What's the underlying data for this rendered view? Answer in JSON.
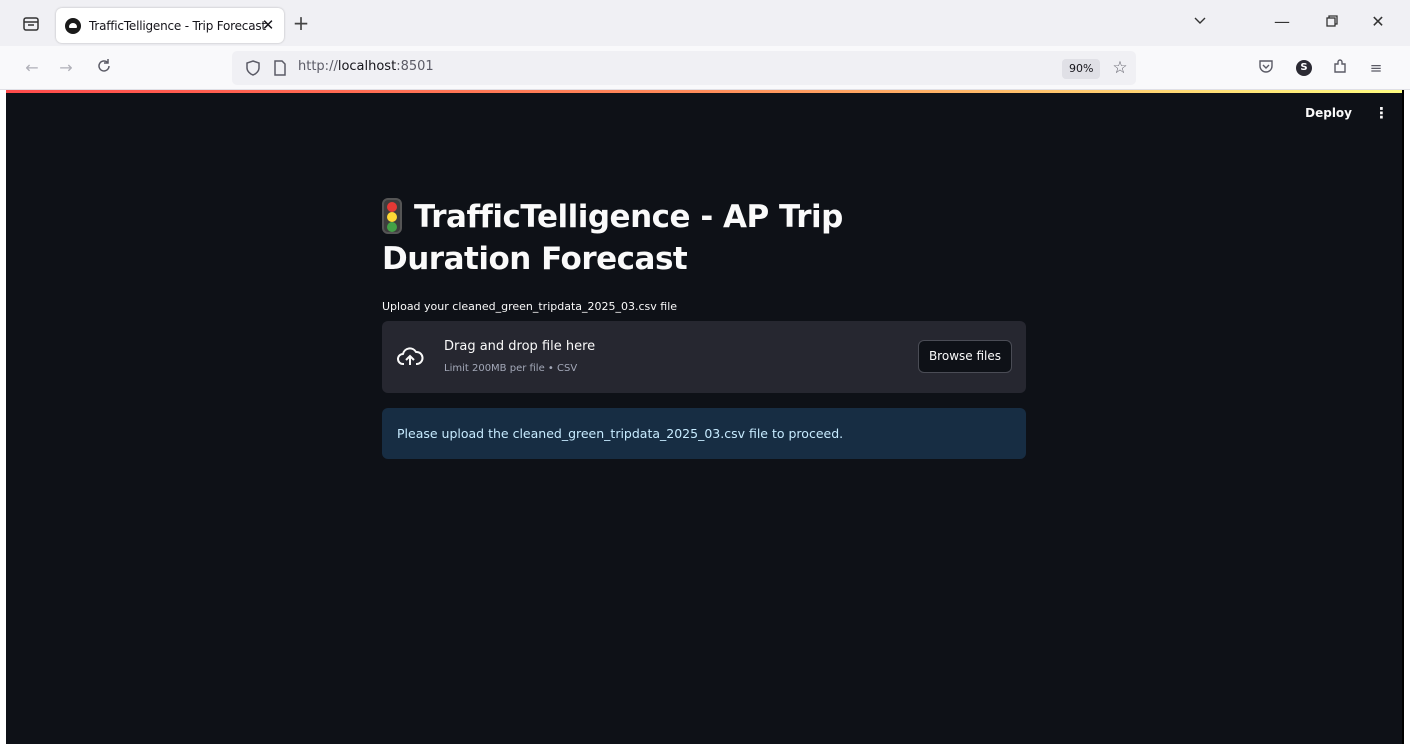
{
  "browser": {
    "tab_title": "TrafficTelligence - Trip Forecast",
    "url_prefix": "http://",
    "url_host": "localhost",
    "url_suffix": ":8501",
    "zoom": "90%"
  },
  "app": {
    "deploy_label": "Deploy",
    "title_line1": "TrafficTelligence - AP Trip",
    "title_line2": "Duration Forecast",
    "upload_label": "Upload your cleaned_green_tripdata_2025_03.csv file",
    "dropzone_main": "Drag and drop file here",
    "dropzone_sub": "Limit 200MB per file • CSV",
    "browse_button": "Browse files",
    "info_message": "Please upload the cleaned_green_tripdata_2025_03.csv file to proceed."
  },
  "icons": {
    "title_emoji": "traffic-light-icon",
    "upload": "cloud-upload-icon"
  },
  "colors": {
    "app_background": "#0e1117",
    "dropzone_background": "#262730",
    "info_background": "#172d43",
    "info_text": "#c7ebff"
  }
}
